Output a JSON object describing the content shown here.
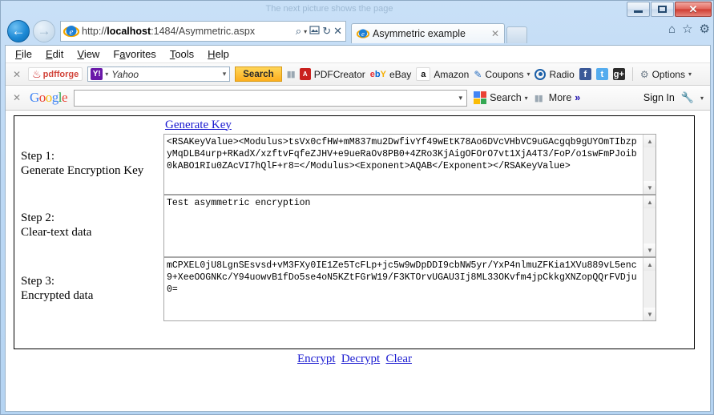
{
  "window": {
    "title": "The next picture shows the page",
    "minimize_label": "Minimize",
    "maximize_label": "Maximize",
    "close_label": "Close"
  },
  "nav": {
    "back_glyph": "←",
    "forward_glyph": "→",
    "address_prefix": "http://",
    "address_host": "localhost",
    "address_rest": ":1484/Asymmetric.aspx",
    "address_full": "http://localhost:1484/Asymmetric.aspx",
    "search_glyph": "⌕",
    "caret_glyph": "▾",
    "compat_glyph": "❑",
    "refresh_glyph": "↻",
    "stop_glyph": "✕"
  },
  "tabs": [
    {
      "title": "Asymmetric example",
      "close_label": "✕"
    }
  ],
  "newtab_label": "",
  "command_icons": {
    "home": "⌂",
    "favorites": "☆",
    "tools": "⚙"
  },
  "menubar": [
    {
      "label": "File",
      "accel": "F",
      "rest": "ile"
    },
    {
      "label": "Edit",
      "accel": "E",
      "rest": "dit"
    },
    {
      "label": "View",
      "accel": "V",
      "rest": "iew"
    },
    {
      "label": "Favorites",
      "accel": "F",
      "rest": "avorites",
      "pre": "F",
      "post": "avorites"
    },
    {
      "label": "Tools",
      "accel": "T",
      "rest": "ools"
    },
    {
      "label": "Help",
      "accel": "H",
      "rest": "elp"
    }
  ],
  "pdfforge_toolbar": {
    "close_label": "✕",
    "brand": "pdfforge",
    "engine": "Yahoo",
    "engine_badge": "Y!",
    "search_button": "Search",
    "items": [
      {
        "label": "PDFCreator",
        "icon": "pdf-icon",
        "caret": false
      },
      {
        "label": "eBay",
        "icon": "ebay-icon",
        "caret": false
      },
      {
        "label": "Amazon",
        "icon": "amazon-icon",
        "caret": false
      },
      {
        "label": "Coupons",
        "icon": "coupons-icon",
        "caret": true
      },
      {
        "label": "Radio",
        "icon": "radio-icon",
        "caret": false
      }
    ],
    "social": [
      {
        "label": "f",
        "name": "facebook-icon"
      },
      {
        "label": "t",
        "name": "twitter-icon"
      },
      {
        "label": "g+",
        "name": "googleplus-icon"
      }
    ],
    "options_label": "Options"
  },
  "google_toolbar": {
    "close_label": "✕",
    "logo": "Google",
    "query": "",
    "placeholder": "",
    "search_label": "Search",
    "more_label": "More",
    "more_glyph": "»",
    "signin_label": "Sign In",
    "wrench_glyph": "ὒ7"
  },
  "page": {
    "generate_key_link": "Generate Key",
    "rows": [
      {
        "label_line1": "Step 1:",
        "label_line2": "Generate Encryption Key",
        "field_name": "key-textarea",
        "value": "<RSAKeyValue><Modulus>tsVx0cfHW+mM837mu2DwfivYf49wEtK78Ao6DVcVHbVC9uGAcgqb9gUYOmTIbzpyMqDLB4urp+RKadX/xzftvFqfeZJHV+e9ueRaOv8PB0+4ZRo3KjAigOFOrO7vt1XjA4T3/FoP/o1swFmPJoib0kABO1RIu0ZAcVI7hQlF+r8=</Modulus><Exponent>AQAB</Exponent></RSAKeyValue>"
      },
      {
        "label_line1": "Step 2:",
        "label_line2": "Clear-text data",
        "field_name": "cleartext-textarea",
        "value": "Test asymmetric encryption"
      },
      {
        "label_line1": "Step 3:",
        "label_line2": "Encrypted data",
        "field_name": "encrypted-textarea",
        "value": "mCPXEL0jU8LgnSEsvsd+vM3FXy0IE1Ze5TcFLp+jc5w9wDpDDI9cbNW5yr/YxP4nlmuZFKia1XVu889vL5enc9+XeeOOGNKc/Y94uowvB1fDo5se4oN5KZtFGrW19/F3KTOrvUGAU3Ij8ML33OKvfm4jpCkkgXNZopQQrFVDju0="
      }
    ],
    "actions": [
      {
        "label": "Encrypt",
        "name": "encrypt-link"
      },
      {
        "label": "Decrypt",
        "name": "decrypt-link"
      },
      {
        "label": "Clear",
        "name": "clear-link"
      }
    ]
  },
  "colors": {
    "link": "#1919d0",
    "search_button": "#fcae1e",
    "close_button": "#cf3c31",
    "frame": "#b5d4f2"
  }
}
